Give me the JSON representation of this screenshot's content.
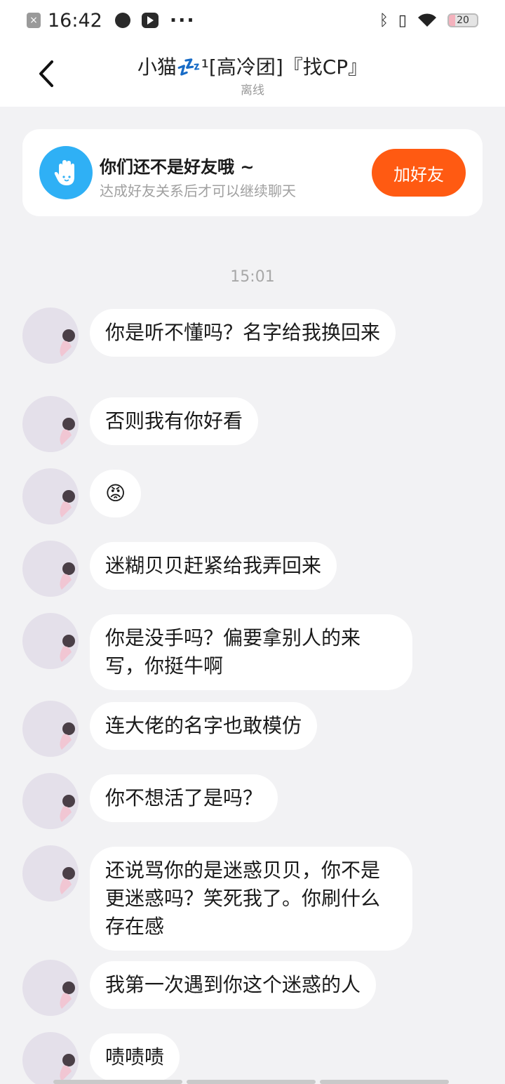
{
  "status_bar": {
    "time": "16:42",
    "dots": "···",
    "battery": "20"
  },
  "header": {
    "title": "小猫💤¹[高冷团]『找CP』",
    "status": "离线"
  },
  "friend_card": {
    "title": "你们还不是好友哦 ~",
    "subtitle": "达成好友关系后才可以继续聊天",
    "button_label": "加好友"
  },
  "timestamp": "15:01",
  "messages": [
    {
      "text": "你是听不懂吗？名字给我换回来"
    },
    {
      "text": "否则我有你好看"
    },
    {
      "text": "😡"
    },
    {
      "text": "迷糊贝贝赶紧给我弄回来"
    },
    {
      "text": "你是没手吗？偏要拿别人的来写，你挺牛啊"
    },
    {
      "text": "连大佬的名字也敢模仿"
    },
    {
      "text": "你不想活了是吗？"
    },
    {
      "text": "还说骂你的是迷惑贝贝，你不是更迷惑吗？笑死我了。你刷什么存在感"
    },
    {
      "text": "我第一次遇到你这个迷惑的人"
    },
    {
      "text": "啧啧啧"
    }
  ],
  "colors": {
    "accent": "#ff5a12",
    "hand_icon": "#2fb0f5",
    "background": "#f2f2f4"
  }
}
